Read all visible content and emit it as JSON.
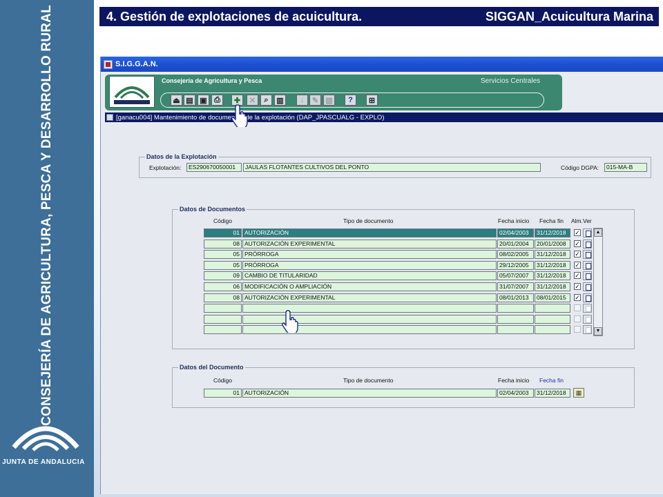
{
  "slide": {
    "title_left": "4. Gestión de explotaciones de acuicultura.",
    "title_right": "SIGGAN_Acuicultura Marina",
    "side_text": "CONSEJERÍA DE AGRICULTURA, PESCA Y DESARROLLO RURAL",
    "side_logo_text": "JUNTA DE ANDALUCIA",
    "accent_color": "#0c1660"
  },
  "app": {
    "window_title": "S.I.G.G.A.N.",
    "header_title": "Consejería de Agricultura y Pesca",
    "header_right": "Servicios Centrales",
    "logo_text": "JUNTA DE ANDALUCIA",
    "subbar_text": "[ganacu004] Mantenimiento de documentos de la explotación  (DAP_JPASCUALG - EXPLO)",
    "toolbar": [
      {
        "icon": "exit-icon",
        "glyph": "⏏",
        "enabled": true
      },
      {
        "icon": "open-folder-icon",
        "glyph": "▤",
        "enabled": true
      },
      {
        "icon": "save-icon",
        "glyph": "▣",
        "enabled": true
      },
      {
        "icon": "print-icon",
        "glyph": "⎙",
        "enabled": true
      },
      {
        "icon": "add-icon",
        "glyph": "✚",
        "enabled": true
      },
      {
        "icon": "delete-icon",
        "glyph": "✕",
        "enabled": false
      },
      {
        "icon": "find-icon",
        "glyph": "⌕",
        "enabled": true
      },
      {
        "icon": "preview-icon",
        "glyph": "▥",
        "enabled": true
      },
      {
        "icon": "down-icon",
        "glyph": "↓",
        "enabled": false
      },
      {
        "icon": "edit-icon",
        "glyph": "✎",
        "enabled": false
      },
      {
        "icon": "clear-icon",
        "glyph": "▧",
        "enabled": false
      },
      {
        "icon": "help-icon",
        "glyph": "?",
        "enabled": true
      },
      {
        "icon": "tree-icon",
        "glyph": "⊞",
        "enabled": true
      }
    ]
  },
  "explotacion": {
    "legend": "Datos de la Explotación",
    "label": "Explotación:",
    "code": "ES290670050001",
    "name": "JAULAS FLOTANTES CULTIVOS DEL PONTO",
    "dgpa_label": "Código DGPA:",
    "dgpa_value": "015-MA-B"
  },
  "documentos": {
    "legend": "Datos de Documentos",
    "columns": {
      "codigo": "Código",
      "tipo": "Tipo de documento",
      "fecha_inicio": "Fecha inicio",
      "fecha_fin": "Fecha fin",
      "alm_ver": "Alm.Ver"
    },
    "rows": [
      {
        "codigo": "01",
        "tipo": "AUTORIZACIÓN",
        "inicio": "02/04/2003",
        "fin": "31/12/2018",
        "checked": "✓",
        "selected": true
      },
      {
        "codigo": "08",
        "tipo": "AUTORIZACIÓN EXPERIMENTAL",
        "inicio": "20/01/2004",
        "fin": "20/01/2008",
        "checked": "✓",
        "selected": false
      },
      {
        "codigo": "05",
        "tipo": "PRÓRROGA",
        "inicio": "08/02/2005",
        "fin": "31/12/2018",
        "checked": "✓",
        "selected": false
      },
      {
        "codigo": "05",
        "tipo": "PRÓRROGA",
        "inicio": "29/12/2005",
        "fin": "31/12/2018",
        "checked": "✓",
        "selected": false
      },
      {
        "codigo": "09",
        "tipo": "CAMBIO DE TITULARIDAD",
        "inicio": "05/07/2007",
        "fin": "31/12/2018",
        "checked": "✓",
        "selected": false
      },
      {
        "codigo": "06",
        "tipo": "MODIFICACIÓN O AMPLIACIÓN",
        "inicio": "31/07/2007",
        "fin": "31/12/2018",
        "checked": "✓",
        "selected": false
      },
      {
        "codigo": "08",
        "tipo": "AUTORIZACIÓN EXPERIMENTAL",
        "inicio": "08/01/2013",
        "fin": "08/01/2015",
        "checked": "✓",
        "selected": false
      },
      {
        "codigo": "",
        "tipo": "",
        "inicio": "",
        "fin": "",
        "checked": "",
        "selected": false
      },
      {
        "codigo": "",
        "tipo": "",
        "inicio": "",
        "fin": "",
        "checked": "",
        "selected": false
      },
      {
        "codigo": "",
        "tipo": "",
        "inicio": "",
        "fin": "",
        "checked": "",
        "selected": false
      }
    ]
  },
  "documento": {
    "legend": "Datos del Documento",
    "columns": {
      "codigo": "Código",
      "tipo": "Tipo de documento",
      "fecha_inicio": "Fecha inicio",
      "fecha_fin": "Fecha fin"
    },
    "codigo": "01",
    "tipo": "AUTORIZACIÓN",
    "inicio": "02/04/2003",
    "fin": "31/12/2018"
  }
}
